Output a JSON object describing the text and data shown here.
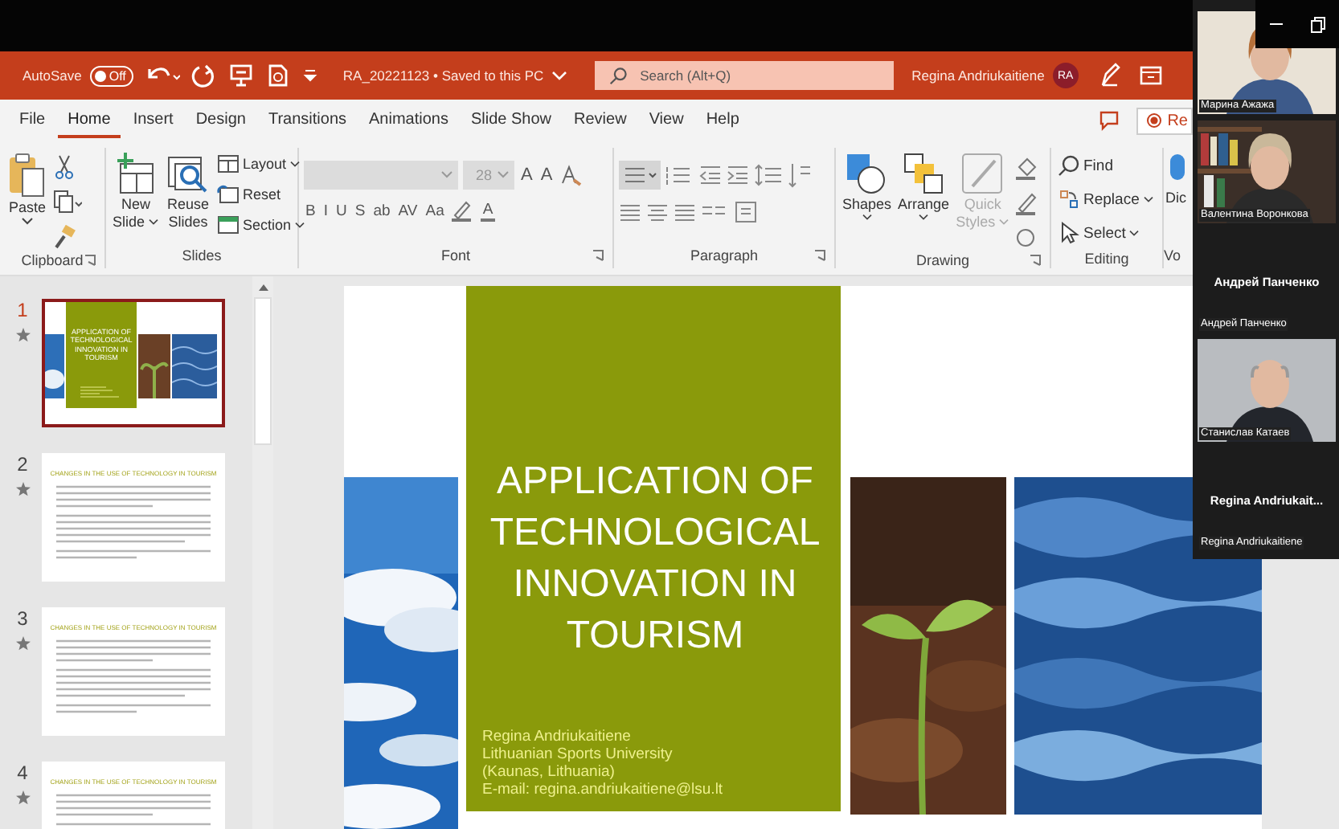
{
  "title_bar": {
    "autosave_label": "AutoSave",
    "autosave": {
      "label": "Off",
      "on": false
    },
    "document": "RA_20221123 • Saved to this PC",
    "search": {
      "placeholder": "Search (Alt+Q)"
    },
    "user_name": "Regina Andriukaitiene",
    "user_initials": "RA"
  },
  "tabs": [
    {
      "label": "File",
      "selected": false
    },
    {
      "label": "Home",
      "selected": true
    },
    {
      "label": "Insert",
      "selected": false
    },
    {
      "label": "Design",
      "selected": false
    },
    {
      "label": "Transitions",
      "selected": false
    },
    {
      "label": "Animations",
      "selected": false
    },
    {
      "label": "Slide Show",
      "selected": false
    },
    {
      "label": "Review",
      "selected": false
    },
    {
      "label": "View",
      "selected": false
    },
    {
      "label": "Help",
      "selected": false
    }
  ],
  "record_button": "Re",
  "ribbon": {
    "clipboard": {
      "label": "Clipboard",
      "paste": "Paste"
    },
    "slides": {
      "label": "Slides",
      "new_slide": [
        "New",
        "Slide"
      ],
      "reuse_slides": [
        "Reuse",
        "Slides"
      ],
      "layout": "Layout",
      "reset": "Reset",
      "section": "Section"
    },
    "font": {
      "label": "Font",
      "size": "28",
      "size_buttons": [
        "A",
        "A"
      ],
      "format_buttons": [
        "B",
        "I",
        "U",
        "S",
        "ab",
        "AV",
        "Aa"
      ],
      "color_button": "A"
    },
    "paragraph": {
      "label": "Paragraph"
    },
    "drawing": {
      "label": "Drawing",
      "shapes": "Shapes",
      "arrange": "Arrange",
      "quick_styles": [
        "Quick",
        "Styles"
      ]
    },
    "editing": {
      "label": "Editing",
      "find": "Find",
      "replace": "Replace",
      "select": "Select"
    },
    "voice": {
      "label": "Vo",
      "button": "Dic"
    }
  },
  "slides": [
    {
      "number": "1",
      "selected": true,
      "kind": "title",
      "title": "APPLICATION OF TECHNOLOGICAL INNOVATION IN TOURISM"
    },
    {
      "number": "2",
      "selected": false,
      "kind": "text",
      "title": "CHANGES IN THE USE OF TECHNOLOGY IN TOURISM"
    },
    {
      "number": "3",
      "selected": false,
      "kind": "text",
      "title": "CHANGES IN THE USE OF TECHNOLOGY IN TOURISM"
    },
    {
      "number": "4",
      "selected": false,
      "kind": "text",
      "title": "CHANGES IN THE USE OF TECHNOLOGY IN TOURISM"
    }
  ],
  "slide": {
    "title": "APPLICATION OF TECHNOLOGICAL INNOVATION IN TOURISM",
    "author_lines": [
      "Regina Andriukaitiene",
      "Lithuanian Sports University",
      "(Kaunas, Lithuania)",
      "E-mail: regina.andriukaitiene@lsu.lt"
    ]
  },
  "participants": [
    {
      "kind": "video",
      "name": "Марина Ажажа"
    },
    {
      "kind": "video",
      "name": "Валентина Воронкова"
    },
    {
      "kind": "name",
      "display_name": "Андрей Панченко",
      "name": "Андрей Панченко"
    },
    {
      "kind": "video",
      "name": "Станислав Катаев"
    },
    {
      "kind": "name",
      "display_name": "Regina  Andriukait...",
      "name": "Regina Andriukaitiene"
    }
  ]
}
